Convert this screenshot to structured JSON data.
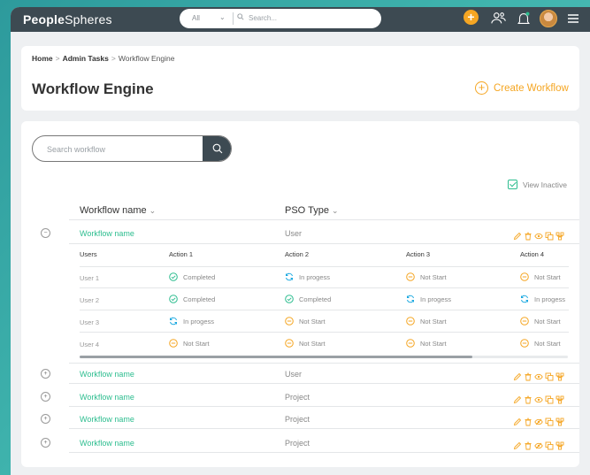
{
  "header": {
    "logo_bold": "People",
    "logo_light": "Spheres",
    "search_scope": "All",
    "search_placeholder": "Search..."
  },
  "breadcrumb": {
    "home": "Home",
    "admin": "Admin Tasks",
    "current": "Workflow Engine"
  },
  "page": {
    "title": "Workflow Engine",
    "create_label": "Create Workflow"
  },
  "filters": {
    "search_placeholder": "Search workflow",
    "view_inactive_label": "View Inactive",
    "view_inactive_checked": true
  },
  "columns": {
    "name": "Workflow name",
    "pso": "PSO Type"
  },
  "subtable": {
    "headers": [
      "Users",
      "Action 1",
      "Action 2",
      "Action 3",
      "Action 4"
    ],
    "rows": [
      {
        "user": "User 1",
        "a1": "Completed",
        "a2": "In progess",
        "a3": "Not Start",
        "a4": "Not Start"
      },
      {
        "user": "User 2",
        "a1": "Completed",
        "a2": "Completed",
        "a3": "In progess",
        "a4": "In progess"
      },
      {
        "user": "User 3",
        "a1": "In progess",
        "a2": "Not Start",
        "a3": "Not Start",
        "a4": "Not Start"
      },
      {
        "user": "User 4",
        "a1": "Not Start",
        "a2": "Not Start",
        "a3": "Not Start",
        "a4": "Not Start"
      }
    ]
  },
  "workflows": [
    {
      "name": "Workflow name",
      "pso": "User"
    },
    {
      "name": "Workflow name",
      "pso": "User"
    },
    {
      "name": "Workflow name",
      "pso": "Project"
    },
    {
      "name": "Workflow name",
      "pso": "Project"
    },
    {
      "name": "Workflow name",
      "pso": "Project"
    }
  ],
  "colors": {
    "accent": "#f5a623",
    "green": "#2dbd8f",
    "topbar": "#3d4a52",
    "info": "#1aa8e0"
  }
}
